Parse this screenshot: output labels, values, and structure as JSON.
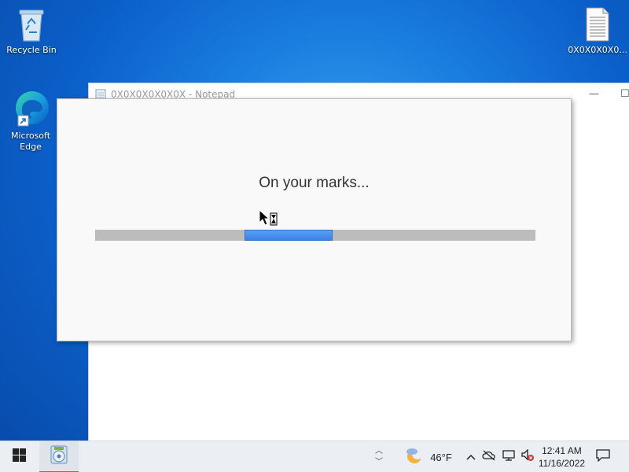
{
  "desktop": {
    "icons": [
      {
        "label": "Recycle Bin"
      },
      {
        "label": "Microsoft Edge"
      },
      {
        "label": "0X0X0X0X0..."
      }
    ]
  },
  "notepad": {
    "title": "0X0X0X0X0X0X - Notepad"
  },
  "splash": {
    "message": "On your marks...",
    "progress_fraction": 0.2
  },
  "taskbar": {
    "weather_temp": "46°F",
    "clock_time": "12:41 AM",
    "clock_date": "11/16/2022"
  },
  "icons": [
    "start-icon",
    "setup-app-icon",
    "overflow-chevron-icon",
    "weather-moon-icon",
    "tray-up-arrow-icon",
    "onedrive-offline-icon",
    "network-icon",
    "volume-muted-icon",
    "notification-icon"
  ],
  "colors": {
    "accent": "#3b82e8",
    "desktop": "#0b5fc8",
    "taskbar": "#ebeef3"
  }
}
